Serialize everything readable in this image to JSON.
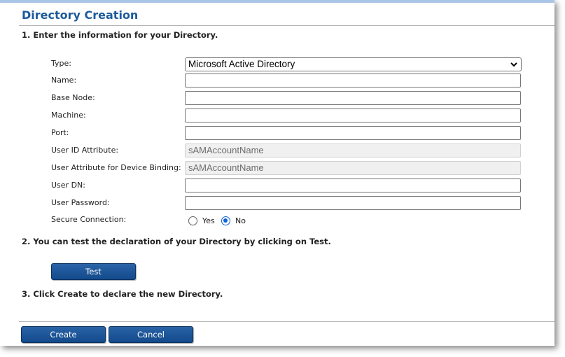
{
  "header": {
    "title": "Directory Creation"
  },
  "steps": {
    "step1": "1. Enter the information for your Directory.",
    "step2": "2. You can test the declaration of your Directory by clicking on Test.",
    "step3": "3. Click Create to declare the new Directory."
  },
  "form": {
    "type": {
      "label": "Type:",
      "selected": "Microsoft Active Directory"
    },
    "name": {
      "label": "Name:",
      "value": ""
    },
    "base_node": {
      "label": "Base Node:",
      "value": ""
    },
    "machine": {
      "label": "Machine:",
      "value": ""
    },
    "port": {
      "label": "Port:",
      "value": ""
    },
    "user_id_attribute": {
      "label": "User ID Attribute:",
      "value": "sAMAccountName"
    },
    "device_binding_attribute": {
      "label": "User Attribute for Device Binding:",
      "value": "sAMAccountName"
    },
    "user_dn": {
      "label": "User DN:",
      "value": ""
    },
    "user_password": {
      "label": "User Password:",
      "value": ""
    },
    "secure_connection": {
      "label": "Secure Connection:",
      "yes_label": "Yes",
      "no_label": "No",
      "selected": "No"
    }
  },
  "buttons": {
    "test": "Test",
    "create": "Create",
    "cancel": "Cancel"
  },
  "colors": {
    "title": "#1d5a9c",
    "button": "#1a4f8f",
    "radio_selected": "#0b63d6"
  }
}
